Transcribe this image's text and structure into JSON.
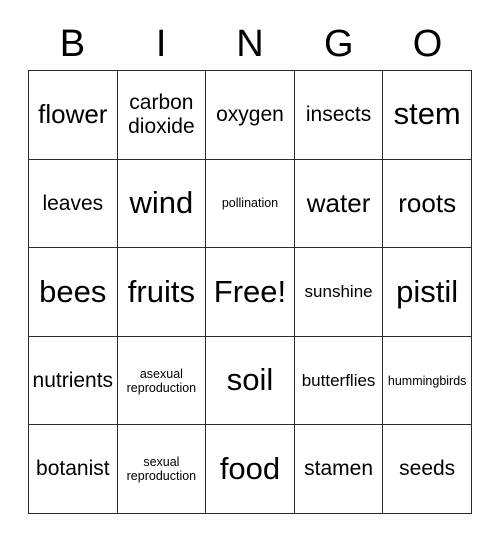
{
  "card": {
    "title_letters": [
      "B",
      "I",
      "N",
      "G",
      "O"
    ],
    "free_space_label": "Free!",
    "grid": [
      [
        {
          "text": "flower",
          "size": "lg"
        },
        {
          "text": "carbon dioxide",
          "size": "md"
        },
        {
          "text": "oxygen",
          "size": "md"
        },
        {
          "text": "insects",
          "size": "md"
        },
        {
          "text": "stem",
          "size": "xl"
        }
      ],
      [
        {
          "text": "leaves",
          "size": "md"
        },
        {
          "text": "wind",
          "size": "xl"
        },
        {
          "text": "pollination",
          "size": "xs"
        },
        {
          "text": "water",
          "size": "lg"
        },
        {
          "text": "roots",
          "size": "lg"
        }
      ],
      [
        {
          "text": "bees",
          "size": "xl"
        },
        {
          "text": "fruits",
          "size": "xl"
        },
        {
          "text": "Free!",
          "size": "xl"
        },
        {
          "text": "sunshine",
          "size": "sm"
        },
        {
          "text": "pistil",
          "size": "xl"
        }
      ],
      [
        {
          "text": "nutrients",
          "size": "md"
        },
        {
          "text": "asexual reproduction",
          "size": "xs"
        },
        {
          "text": "soil",
          "size": "xl"
        },
        {
          "text": "butterflies",
          "size": "sm"
        },
        {
          "text": "hummingbirds",
          "size": "xs"
        }
      ],
      [
        {
          "text": "botanist",
          "size": "md"
        },
        {
          "text": "sexual reproduction",
          "size": "xs"
        },
        {
          "text": "food",
          "size": "xl"
        },
        {
          "text": "stamen",
          "size": "md"
        },
        {
          "text": "seeds",
          "size": "md"
        }
      ]
    ],
    "colors": {
      "border": "#2b2b2b",
      "text": "#000000",
      "background": "#ffffff"
    }
  }
}
